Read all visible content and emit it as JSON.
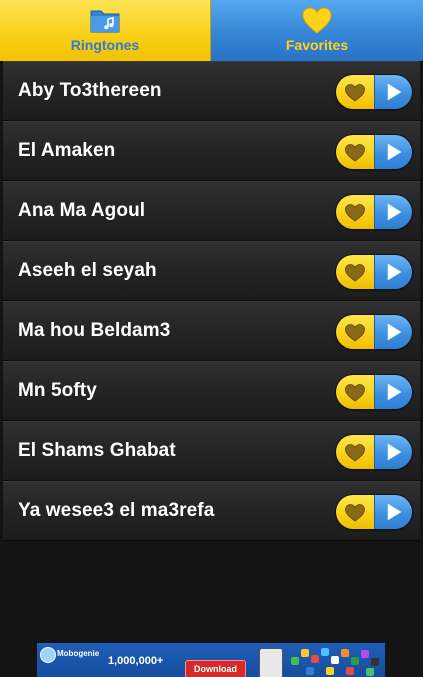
{
  "tabs": [
    {
      "label": "Ringtones",
      "icon": "folder-music-icon",
      "active": true
    },
    {
      "label": "Favorites",
      "icon": "heart-icon",
      "active": false
    }
  ],
  "list": {
    "items": [
      {
        "title": "Aby To3thereen"
      },
      {
        "title": "El Amaken"
      },
      {
        "title": "Ana Ma Agoul"
      },
      {
        "title": "Aseeh el seyah"
      },
      {
        "title": "Ma hou Beldam3"
      },
      {
        "title": "Mn 5ofty"
      },
      {
        "title": "El Shams Ghabat"
      },
      {
        "title": "Ya wesee3 el ma3refa"
      }
    ]
  },
  "ad": {
    "brand": "Mobogenie",
    "count": "1,000,000+",
    "cta": "Download"
  },
  "colors": {
    "yellow": "#fbd21c",
    "blue": "#3e8fe0",
    "heart_gold": "#8a6a16",
    "background": "#141414"
  }
}
